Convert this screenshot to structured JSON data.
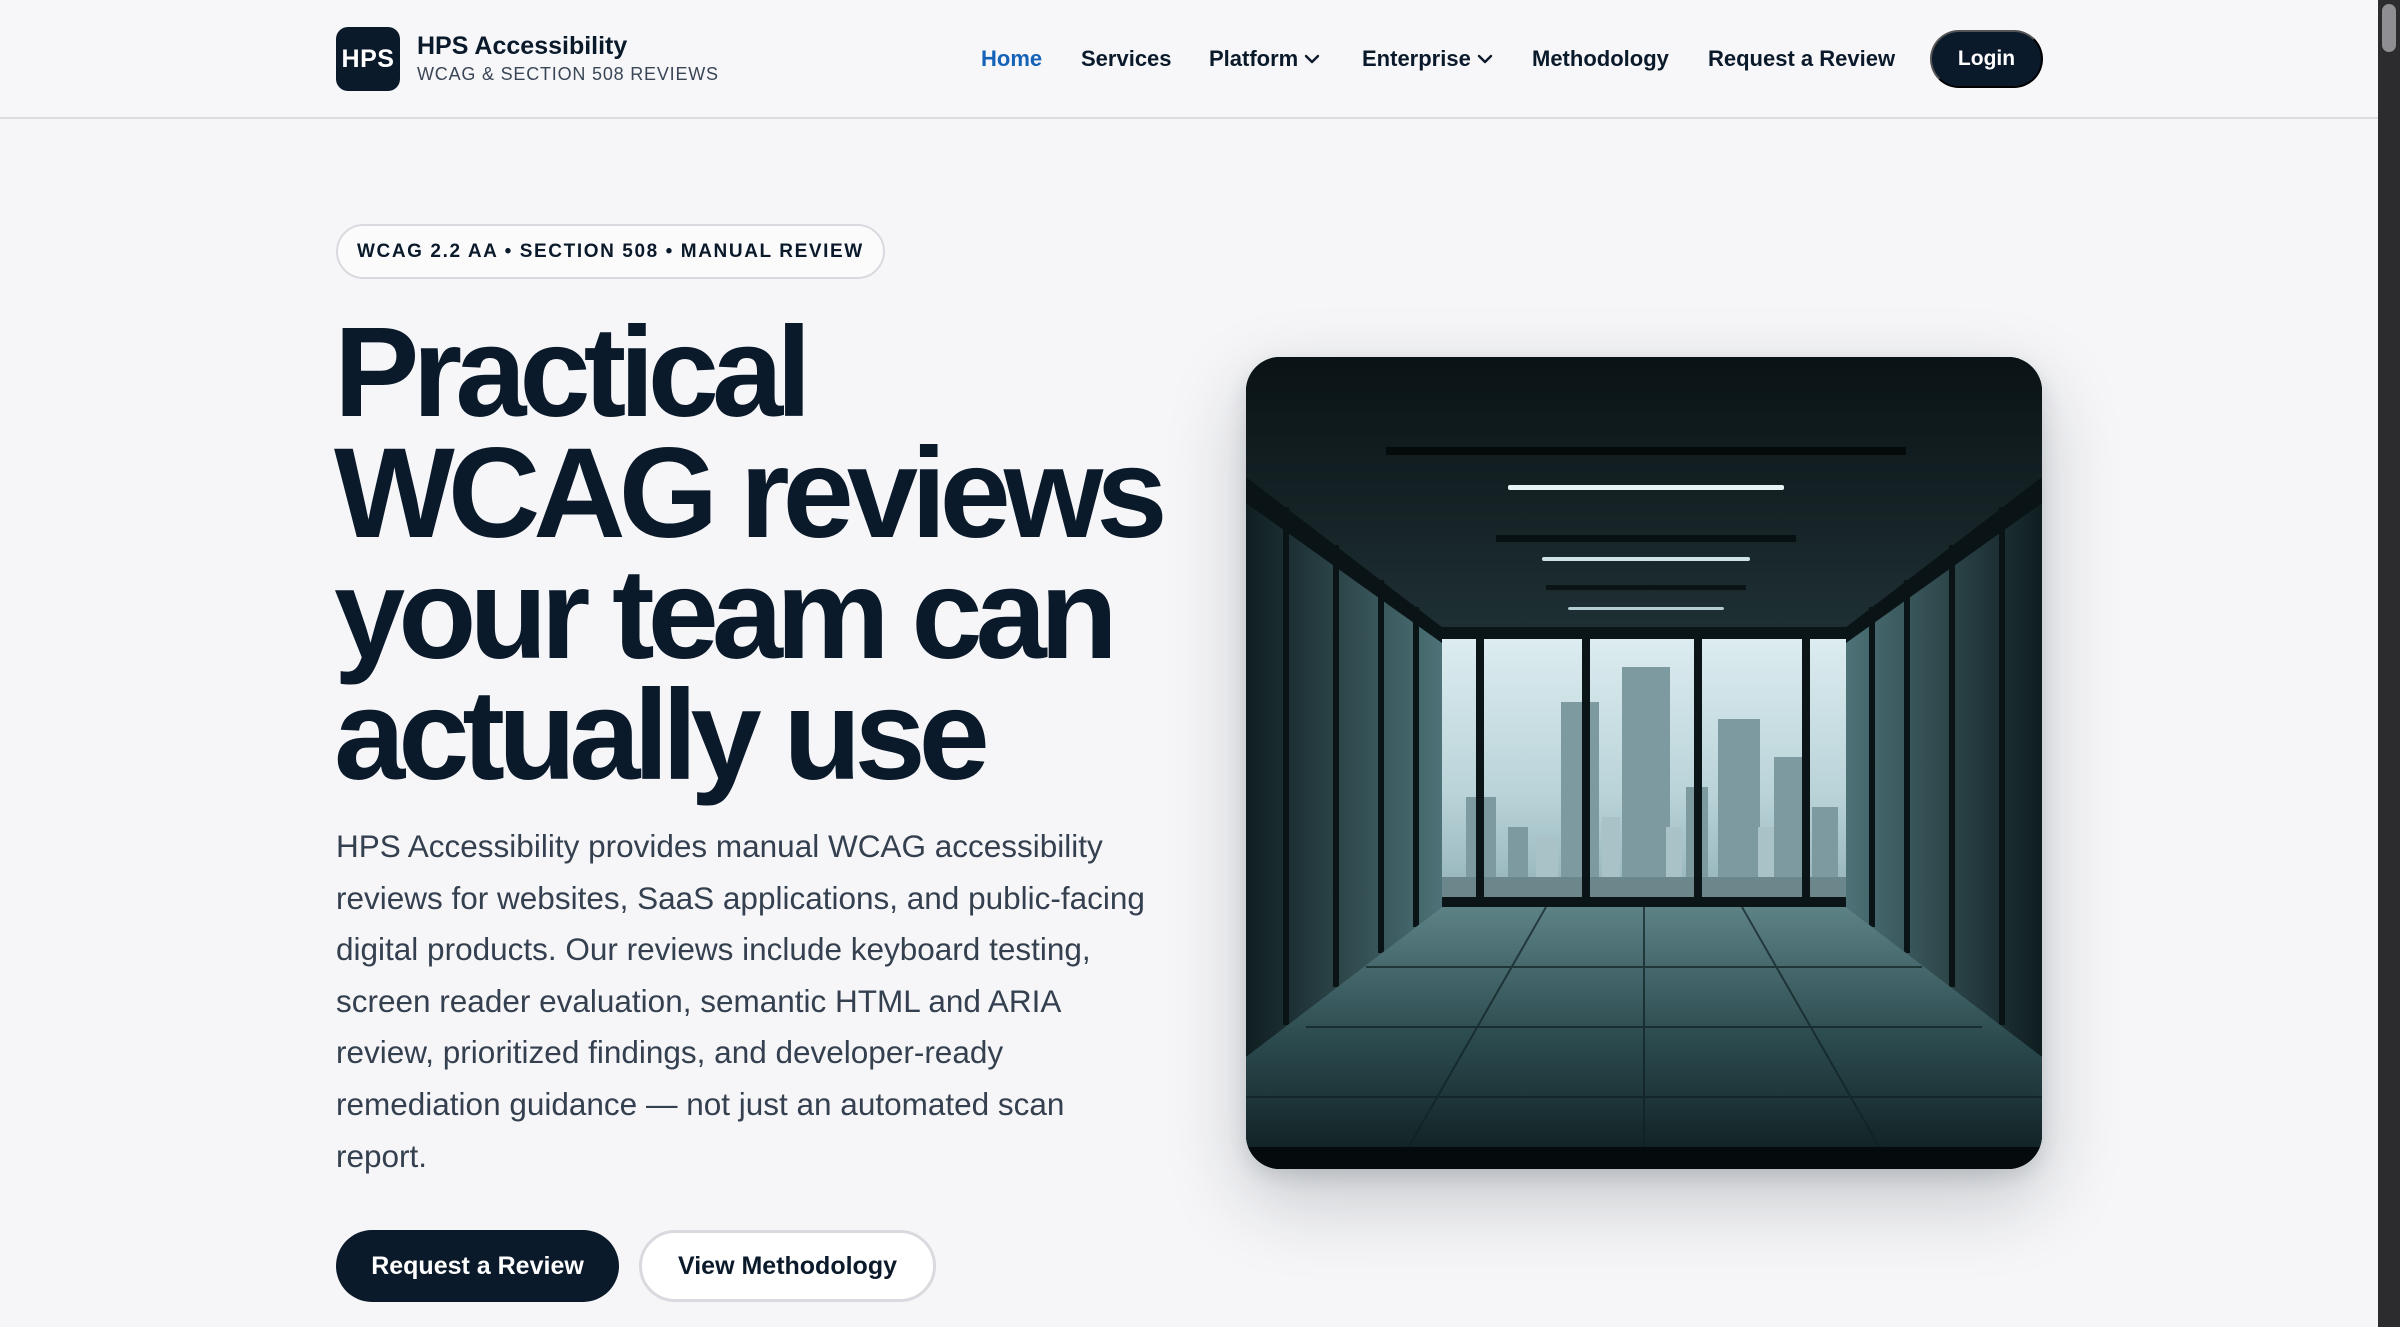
{
  "header": {
    "logo_text": "HPS",
    "brand_name": "HPS Accessibility",
    "brand_tagline": "WCAG & SECTION 508 REVIEWS",
    "nav": [
      {
        "label": "Home",
        "active": true,
        "dropdown": false
      },
      {
        "label": "Services",
        "active": false,
        "dropdown": false
      },
      {
        "label": "Platform",
        "active": false,
        "dropdown": true
      },
      {
        "label": "Enterprise",
        "active": false,
        "dropdown": true
      },
      {
        "label": "Methodology",
        "active": false,
        "dropdown": false
      },
      {
        "label": "Request a Review",
        "active": false,
        "dropdown": false
      }
    ],
    "login_label": "Login"
  },
  "hero": {
    "badge": "WCAG 2.2 AA • SECTION 508 • MANUAL REVIEW",
    "title_lines": [
      "Practical",
      "WCAG reviews",
      "your team can",
      "actually use"
    ],
    "description": "HPS Accessibility provides manual WCAG accessibility reviews for websites, SaaS applications, and public-facing digital products. Our reviews include keyboard testing, screen reader evaluation, semantic HTML and ARIA review, prioritized findings, and developer-ready remediation guidance — not just an automated scan report.",
    "primary_cta": "Request a Review",
    "secondary_cta": "View Methodology"
  },
  "colors": {
    "navy": "#0b1a2b",
    "active_link": "#1463b8",
    "page_bg": "#f6f6f8"
  },
  "icons": {
    "dropdown": "chevron-down-icon",
    "hero_image": "glass-office-city-view"
  }
}
